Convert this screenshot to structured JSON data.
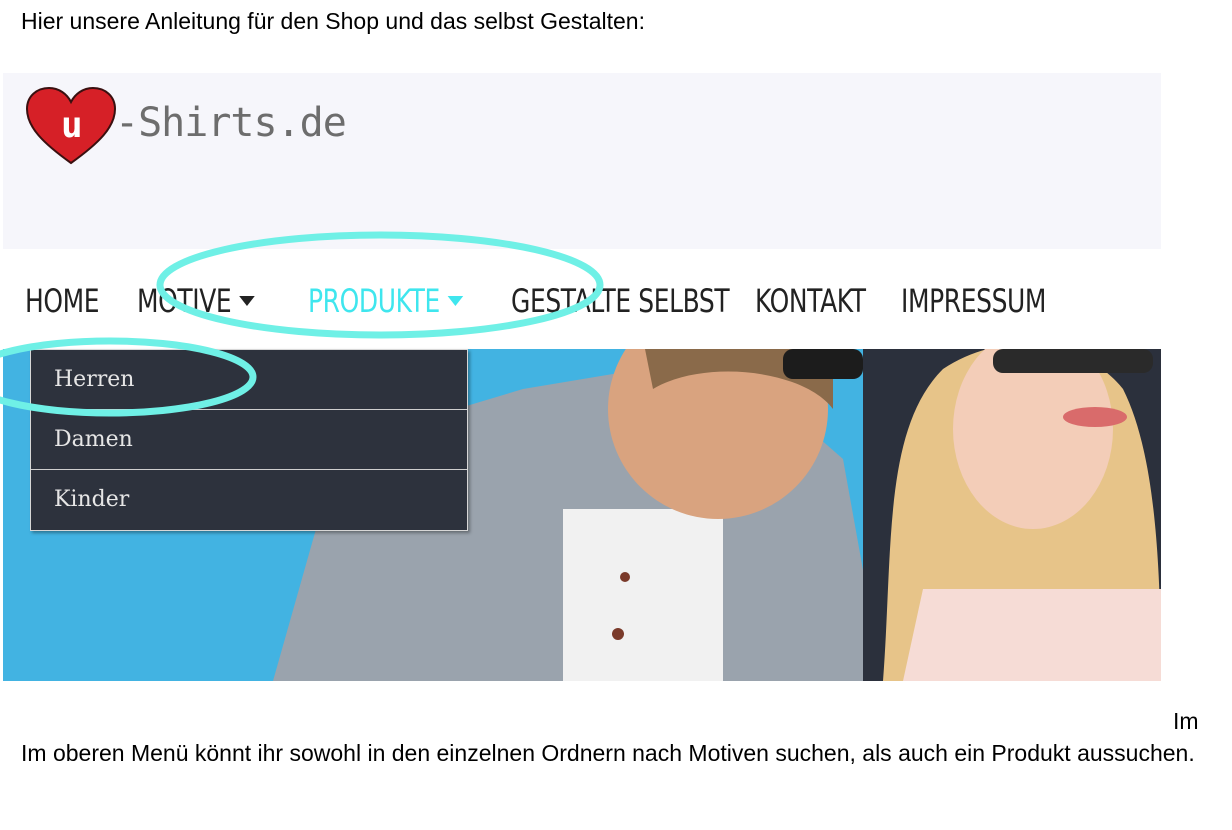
{
  "intro_text": "Hier unsere Anleitung für den Shop und das selbst Gestalten:",
  "logo": {
    "heart_letter": "u",
    "text": "-Shirts.de"
  },
  "nav": {
    "items": [
      {
        "label": "HOME"
      },
      {
        "label": "MOTIVE"
      },
      {
        "label": "PRODUKTE"
      },
      {
        "label": "GESTALTE SELBST"
      },
      {
        "label": "KONTAKT"
      },
      {
        "label": "IMPRESSUM"
      }
    ]
  },
  "dropdown": {
    "items": [
      {
        "label": "Herren"
      },
      {
        "label": "Damen"
      },
      {
        "label": "Kinder"
      }
    ]
  },
  "colors": {
    "highlight": "#6ff0e6",
    "nav_active": "#3fe6ee",
    "dropdown_bg": "#2d323d",
    "logo_heart": "#d62027"
  },
  "fragment_text": "Im",
  "description": "Im oberen Menü könnt ihr sowohl in den einzelnen Ordnern nach Motiven suchen, als auch ein Produkt aussuchen."
}
